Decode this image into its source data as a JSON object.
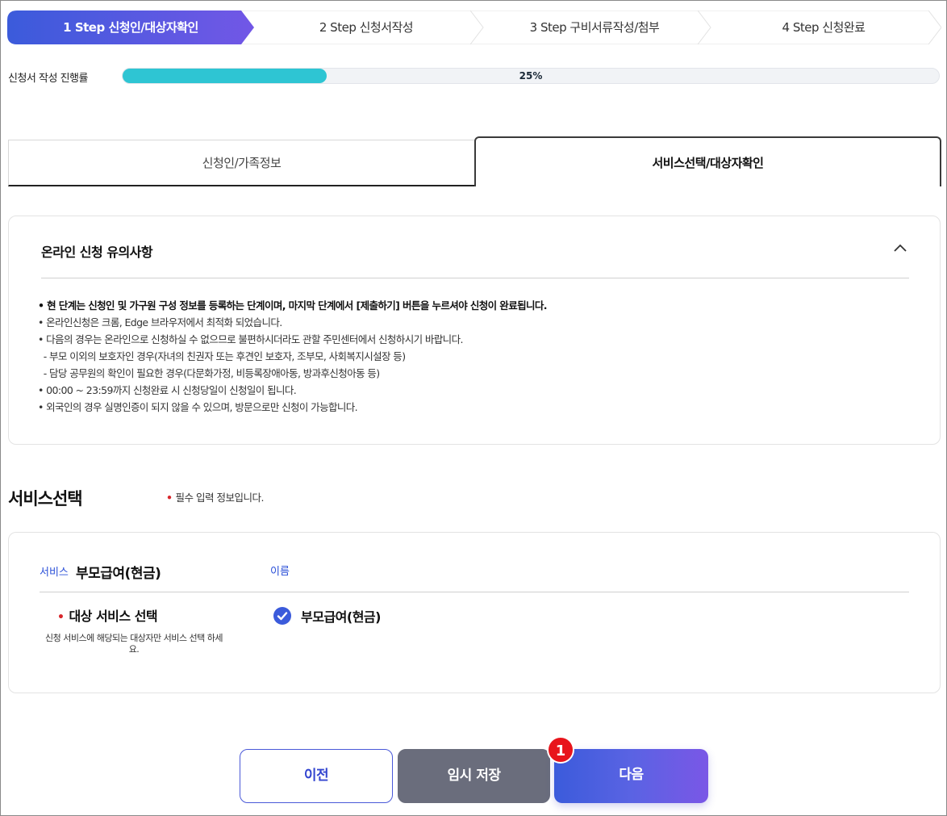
{
  "steps": [
    {
      "label": "1 Step 신청인/대상자확인",
      "active": true
    },
    {
      "label": "2 Step 신청서작성",
      "active": false
    },
    {
      "label": "3 Step 구비서류작성/첨부",
      "active": false
    },
    {
      "label": "4 Step 신청완료",
      "active": false
    }
  ],
  "progress": {
    "label": "신청서 작성 진행률",
    "value_text": "25%",
    "fraction": 0.25
  },
  "tabs": [
    {
      "label": "신청인/가족정보",
      "active": false
    },
    {
      "label": "서비스선택/대상자확인",
      "active": true
    }
  ],
  "notice": {
    "title": "온라인 신청 유의사항",
    "items": [
      "• 현 단계는 신청인 및 가구원 구성 정보를 등록하는 단계이며, 마지막 단계에서 [제출하기] 버튼을 누르셔야 신청이 완료됩니다.",
      "• 온라인신청은 크롬, Edge 브라우저에서 최적화 되었습니다.",
      "• 다음의 경우는 온라인으로 신청하실 수 없으므로 불편하시더라도 관할 주민센터에서 신청하시기 바랍니다.",
      "  - 부모 이외의 보호자인 경우(자녀의 친권자 또는 후견인 보호자, 조부모, 사회복지시설장 등)",
      "  - 담당 공무원의 확인이 필요한 경우(다문화가정, 비등록장애아동, 방과후신청아동 등)",
      "• 00:00 ~ 23:59까지 신청완료 시 신청당일이 신청일이 됩니다.",
      "• 외국인의 경우 실명인증이 되지 않을 수 있으며, 방문으로만 신청이 가능합니다."
    ]
  },
  "service_section": {
    "title": "서비스선택",
    "required_note": "필수 입력 정보입니다.",
    "service_label": "서비스",
    "service_value": "부모급여(현금)",
    "name_column": "이름",
    "target_label": "대상 서비스 선택",
    "target_help": "신청 서비스에 해당되는 대상자만 서비스 선택 하세요.",
    "option_label": "부모급여(현금)",
    "option_checked": true
  },
  "buttons": {
    "prev": "이전",
    "save": "임시 저장",
    "next": "다음"
  },
  "badge": "1",
  "colors": {
    "accent": "#3b5bdb",
    "progress": "#2ec5d3",
    "required": "#d8262b",
    "save_button": "#6a6d7c"
  }
}
